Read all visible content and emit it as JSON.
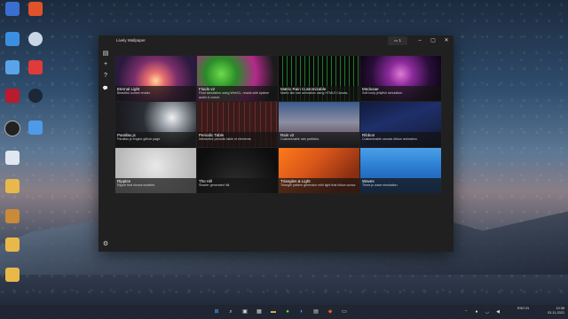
{
  "window": {
    "title": "Lively Wallpaper",
    "monitor_badge": "1"
  },
  "sidebar": {
    "library_icon": "▤",
    "add_icon": "+",
    "help_icon": "?",
    "chat_icon": "💬",
    "settings_icon": "⚙"
  },
  "tiles": [
    {
      "name": "Eternal Light",
      "desc": "Beautiful sunset render."
    },
    {
      "name": "Fluids v2",
      "desc": "Fluid simulation using WebGL, reacts with system audio & cursor."
    },
    {
      "name": "Matrix Rain Customizable",
      "desc": "Matrix like rain animation using HTML5 Canvas."
    },
    {
      "name": "Medusae",
      "desc": "Soft body jellyfish simulation."
    },
    {
      "name": "Parallax.js",
      "desc": "Parallax.js engine github page."
    },
    {
      "name": "Periodic Table",
      "desc": "Interactive periodic table of elements."
    },
    {
      "name": "Rain v2",
      "desc": "Customizable rain particles."
    },
    {
      "name": "Ribbon",
      "desc": "Customizable canvas ribbon animation."
    },
    {
      "name": "Ripples",
      "desc": "Ripple that shows weather."
    },
    {
      "name": "The Hill",
      "desc": "Shader generated hill."
    },
    {
      "name": "Triangles & Light",
      "desc": "Triangle pattern generator with light that follow cursor."
    },
    {
      "name": "Waves",
      "desc": "Three.js wave simulation."
    }
  ],
  "taskbar": {
    "lang": "ENG\nIN",
    "time": "10:38",
    "date": "03-11-2021"
  },
  "colors": {
    "window_bg": "#202020",
    "accent": "#0078d4"
  }
}
